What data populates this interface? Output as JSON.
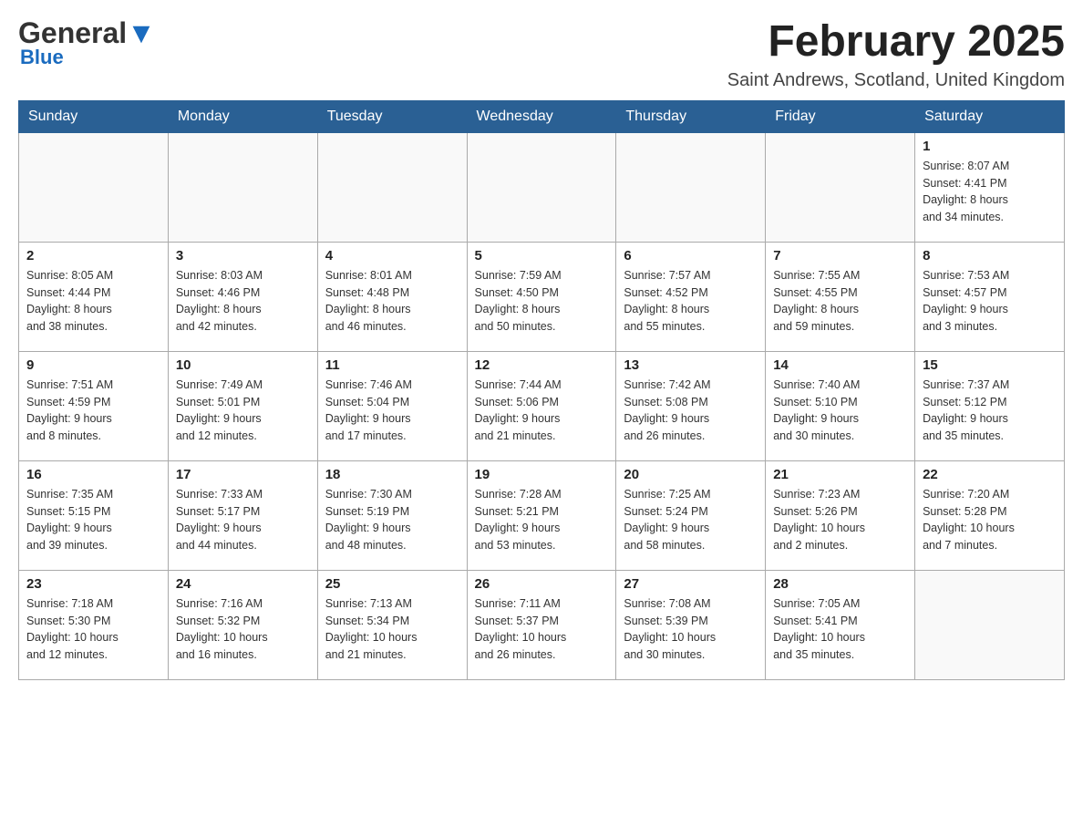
{
  "logo": {
    "general": "General",
    "blue": "Blue"
  },
  "title": "February 2025",
  "subtitle": "Saint Andrews, Scotland, United Kingdom",
  "weekdays": [
    "Sunday",
    "Monday",
    "Tuesday",
    "Wednesday",
    "Thursday",
    "Friday",
    "Saturday"
  ],
  "weeks": [
    [
      {
        "day": "",
        "info": ""
      },
      {
        "day": "",
        "info": ""
      },
      {
        "day": "",
        "info": ""
      },
      {
        "day": "",
        "info": ""
      },
      {
        "day": "",
        "info": ""
      },
      {
        "day": "",
        "info": ""
      },
      {
        "day": "1",
        "info": "Sunrise: 8:07 AM\nSunset: 4:41 PM\nDaylight: 8 hours\nand 34 minutes."
      }
    ],
    [
      {
        "day": "2",
        "info": "Sunrise: 8:05 AM\nSunset: 4:44 PM\nDaylight: 8 hours\nand 38 minutes."
      },
      {
        "day": "3",
        "info": "Sunrise: 8:03 AM\nSunset: 4:46 PM\nDaylight: 8 hours\nand 42 minutes."
      },
      {
        "day": "4",
        "info": "Sunrise: 8:01 AM\nSunset: 4:48 PM\nDaylight: 8 hours\nand 46 minutes."
      },
      {
        "day": "5",
        "info": "Sunrise: 7:59 AM\nSunset: 4:50 PM\nDaylight: 8 hours\nand 50 minutes."
      },
      {
        "day": "6",
        "info": "Sunrise: 7:57 AM\nSunset: 4:52 PM\nDaylight: 8 hours\nand 55 minutes."
      },
      {
        "day": "7",
        "info": "Sunrise: 7:55 AM\nSunset: 4:55 PM\nDaylight: 8 hours\nand 59 minutes."
      },
      {
        "day": "8",
        "info": "Sunrise: 7:53 AM\nSunset: 4:57 PM\nDaylight: 9 hours\nand 3 minutes."
      }
    ],
    [
      {
        "day": "9",
        "info": "Sunrise: 7:51 AM\nSunset: 4:59 PM\nDaylight: 9 hours\nand 8 minutes."
      },
      {
        "day": "10",
        "info": "Sunrise: 7:49 AM\nSunset: 5:01 PM\nDaylight: 9 hours\nand 12 minutes."
      },
      {
        "day": "11",
        "info": "Sunrise: 7:46 AM\nSunset: 5:04 PM\nDaylight: 9 hours\nand 17 minutes."
      },
      {
        "day": "12",
        "info": "Sunrise: 7:44 AM\nSunset: 5:06 PM\nDaylight: 9 hours\nand 21 minutes."
      },
      {
        "day": "13",
        "info": "Sunrise: 7:42 AM\nSunset: 5:08 PM\nDaylight: 9 hours\nand 26 minutes."
      },
      {
        "day": "14",
        "info": "Sunrise: 7:40 AM\nSunset: 5:10 PM\nDaylight: 9 hours\nand 30 minutes."
      },
      {
        "day": "15",
        "info": "Sunrise: 7:37 AM\nSunset: 5:12 PM\nDaylight: 9 hours\nand 35 minutes."
      }
    ],
    [
      {
        "day": "16",
        "info": "Sunrise: 7:35 AM\nSunset: 5:15 PM\nDaylight: 9 hours\nand 39 minutes."
      },
      {
        "day": "17",
        "info": "Sunrise: 7:33 AM\nSunset: 5:17 PM\nDaylight: 9 hours\nand 44 minutes."
      },
      {
        "day": "18",
        "info": "Sunrise: 7:30 AM\nSunset: 5:19 PM\nDaylight: 9 hours\nand 48 minutes."
      },
      {
        "day": "19",
        "info": "Sunrise: 7:28 AM\nSunset: 5:21 PM\nDaylight: 9 hours\nand 53 minutes."
      },
      {
        "day": "20",
        "info": "Sunrise: 7:25 AM\nSunset: 5:24 PM\nDaylight: 9 hours\nand 58 minutes."
      },
      {
        "day": "21",
        "info": "Sunrise: 7:23 AM\nSunset: 5:26 PM\nDaylight: 10 hours\nand 2 minutes."
      },
      {
        "day": "22",
        "info": "Sunrise: 7:20 AM\nSunset: 5:28 PM\nDaylight: 10 hours\nand 7 minutes."
      }
    ],
    [
      {
        "day": "23",
        "info": "Sunrise: 7:18 AM\nSunset: 5:30 PM\nDaylight: 10 hours\nand 12 minutes."
      },
      {
        "day": "24",
        "info": "Sunrise: 7:16 AM\nSunset: 5:32 PM\nDaylight: 10 hours\nand 16 minutes."
      },
      {
        "day": "25",
        "info": "Sunrise: 7:13 AM\nSunset: 5:34 PM\nDaylight: 10 hours\nand 21 minutes."
      },
      {
        "day": "26",
        "info": "Sunrise: 7:11 AM\nSunset: 5:37 PM\nDaylight: 10 hours\nand 26 minutes."
      },
      {
        "day": "27",
        "info": "Sunrise: 7:08 AM\nSunset: 5:39 PM\nDaylight: 10 hours\nand 30 minutes."
      },
      {
        "day": "28",
        "info": "Sunrise: 7:05 AM\nSunset: 5:41 PM\nDaylight: 10 hours\nand 35 minutes."
      },
      {
        "day": "",
        "info": ""
      }
    ]
  ]
}
